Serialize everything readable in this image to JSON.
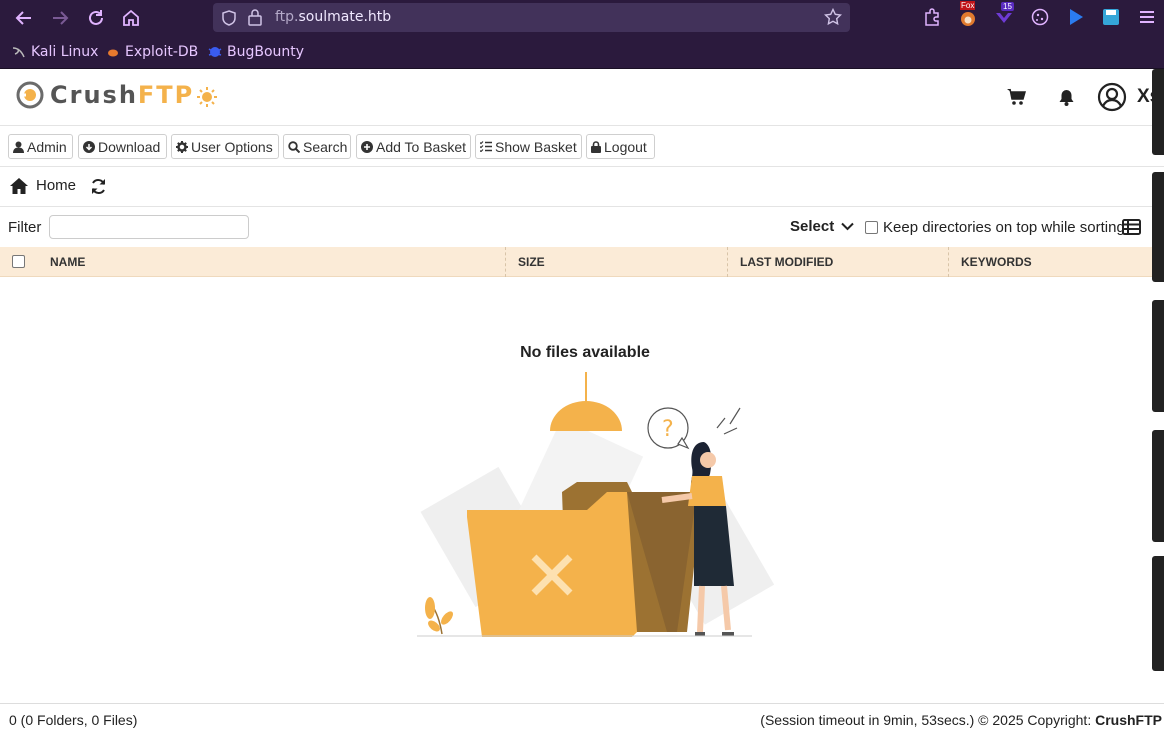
{
  "browser": {
    "url_prefix": "ftp.",
    "url_domain": "soulmate.htb",
    "ext_badges": {
      "fox": "Fox",
      "count": "15"
    },
    "bookmarks": [
      {
        "label": "Kali Linux",
        "icon": "kali-dragon-icon"
      },
      {
        "label": "Exploit-DB",
        "icon": "exploitdb-bug-icon"
      },
      {
        "label": "BugBounty",
        "icon": "bugbounty-icon"
      }
    ]
  },
  "app": {
    "logo_part1": "Crush",
    "logo_part2": "FTP",
    "username": "Xs",
    "toolbar": {
      "admin": "Admin",
      "download": "Download",
      "user_options": "User Options",
      "search": "Search",
      "add_to_basket": "Add To Basket",
      "show_basket": "Show Basket",
      "logout": "Logout"
    },
    "breadcrumb": {
      "home": "Home"
    },
    "filter": {
      "label": "Filter",
      "value": "",
      "select_label": "Select",
      "keep_dirs_label": "Keep directories on top while sorting"
    },
    "table": {
      "columns": [
        "NAME",
        "SIZE",
        "LAST MODIFIED",
        "KEYWORDS"
      ]
    },
    "empty": {
      "title": "No files available"
    },
    "footer": {
      "summary": "0 (0 Folders, 0 Files)",
      "session": "(Session timeout in 9min, 53secs.) © 2025 Copyright: ",
      "brand": "CrushFTP"
    }
  },
  "colors": {
    "accent": "#f4b24b",
    "header_row": "#fbebd7",
    "browser_bg": "#2b1a3d"
  }
}
